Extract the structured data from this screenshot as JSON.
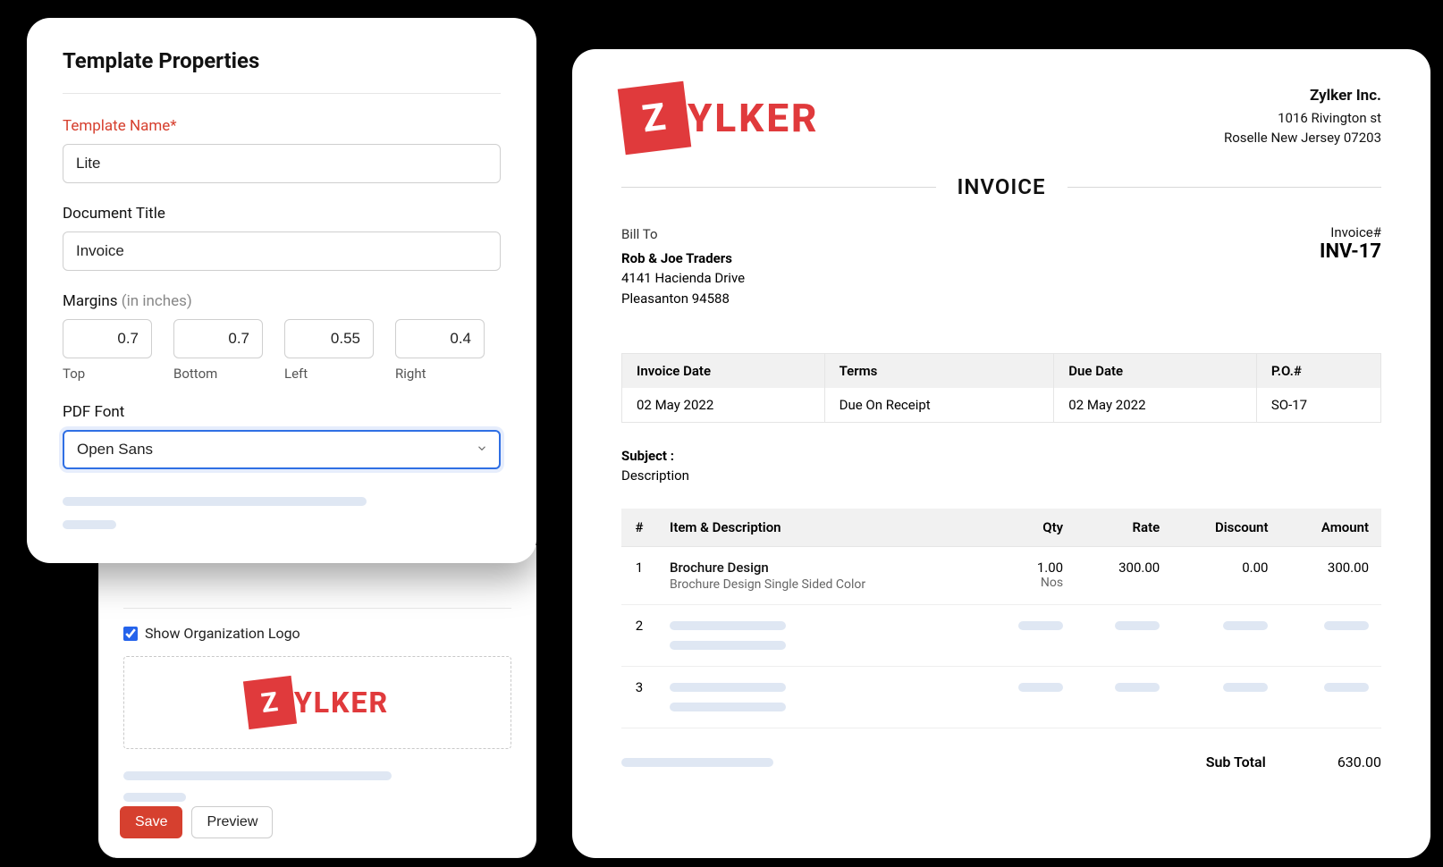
{
  "props": {
    "heading": "Template Properties",
    "template_name_label": "Template Name*",
    "template_name_value": "Lite",
    "doc_title_label": "Document Title",
    "doc_title_value": "Invoice",
    "margins_label": "Margins",
    "margins_unit": "(in inches)",
    "margins": {
      "top": {
        "label": "Top",
        "value": "0.7"
      },
      "bottom": {
        "label": "Bottom",
        "value": "0.7"
      },
      "left": {
        "label": "Left",
        "value": "0.55"
      },
      "right": {
        "label": "Right",
        "value": "0.4"
      }
    },
    "pdf_font_label": "PDF Font",
    "pdf_font_value": "Open Sans"
  },
  "lower": {
    "show_logo_label": "Show Organization Logo",
    "show_logo_checked": true,
    "save_label": "Save",
    "preview_label": "Preview"
  },
  "logo": {
    "letter": "Z",
    "word": "YLKER"
  },
  "invoice": {
    "company": {
      "name": "Zylker Inc.",
      "line1": "1016 Rivington st",
      "line2": "Roselle New Jersey 07203"
    },
    "title": "INVOICE",
    "bill_to_label": "Bill To",
    "bill_to_name": "Rob & Joe Traders",
    "bill_to_line1": "4141 Hacienda Drive",
    "bill_to_line2": "Pleasanton 94588",
    "invoice_no_label": "Invoice#",
    "invoice_no": "INV-17",
    "meta_headers": {
      "date": "Invoice Date",
      "terms": "Terms",
      "due": "Due Date",
      "po": "P.O.#"
    },
    "meta_values": {
      "date": "02 May 2022",
      "terms": "Due On Receipt",
      "due": "02 May 2022",
      "po": "SO-17"
    },
    "subject_label": "Subject :",
    "subject_value": "Description",
    "item_headers": {
      "num": "#",
      "item": "Item & Description",
      "qty": "Qty",
      "rate": "Rate",
      "disc": "Discount",
      "amount": "Amount"
    },
    "row1": {
      "num": "1",
      "name": "Brochure Design",
      "desc": "Brochure Design Single Sided Color",
      "qty": "1.00",
      "qty_unit": "Nos",
      "rate": "300.00",
      "disc": "0.00",
      "amount": "300.00"
    },
    "row2_num": "2",
    "row3_num": "3",
    "subtotal_label": "Sub Total",
    "subtotal_value": "630.00"
  }
}
